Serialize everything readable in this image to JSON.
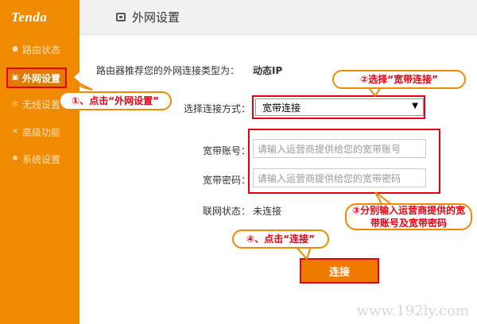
{
  "sidebar": {
    "logo": "Tenda",
    "items": [
      {
        "label": "路由状态",
        "icon": "dashboard-icon"
      },
      {
        "label": "外网设置",
        "icon": "internet-icon"
      },
      {
        "label": "无线设置",
        "icon": "wifi-icon"
      },
      {
        "label": "高级功能",
        "icon": "tools-icon"
      },
      {
        "label": "系统设置",
        "icon": "gear-icon"
      }
    ]
  },
  "header": {
    "title": "外网设置",
    "icon": "internet-icon"
  },
  "main": {
    "recommend_label": "路由器推荐您的外网连接类型为：",
    "recommend_value": "动态IP",
    "mode_label": "选择连接方式：",
    "mode_value": "宽带连接",
    "account_label": "宽带账号：",
    "account_placeholder": "请输入运营商提供给您的宽带账号",
    "password_label": "宽带密码：",
    "password_placeholder": "请输入运营商提供给您的宽带密码",
    "status_label": "联网状态：",
    "status_value": "未连接",
    "connect_label": "连接"
  },
  "annotations": {
    "step1": "①、点击“外网设置”",
    "step2": "②选择“宽带连接”",
    "step3_line1": "③分别输入运营商提供的宽",
    "step3_line2": "带账号及宽带密码",
    "step4": "④、点击“连接”"
  },
  "watermark": "www.192ly.com",
  "colors": {
    "brand": "#f08a00",
    "highlight": "#e60012"
  }
}
